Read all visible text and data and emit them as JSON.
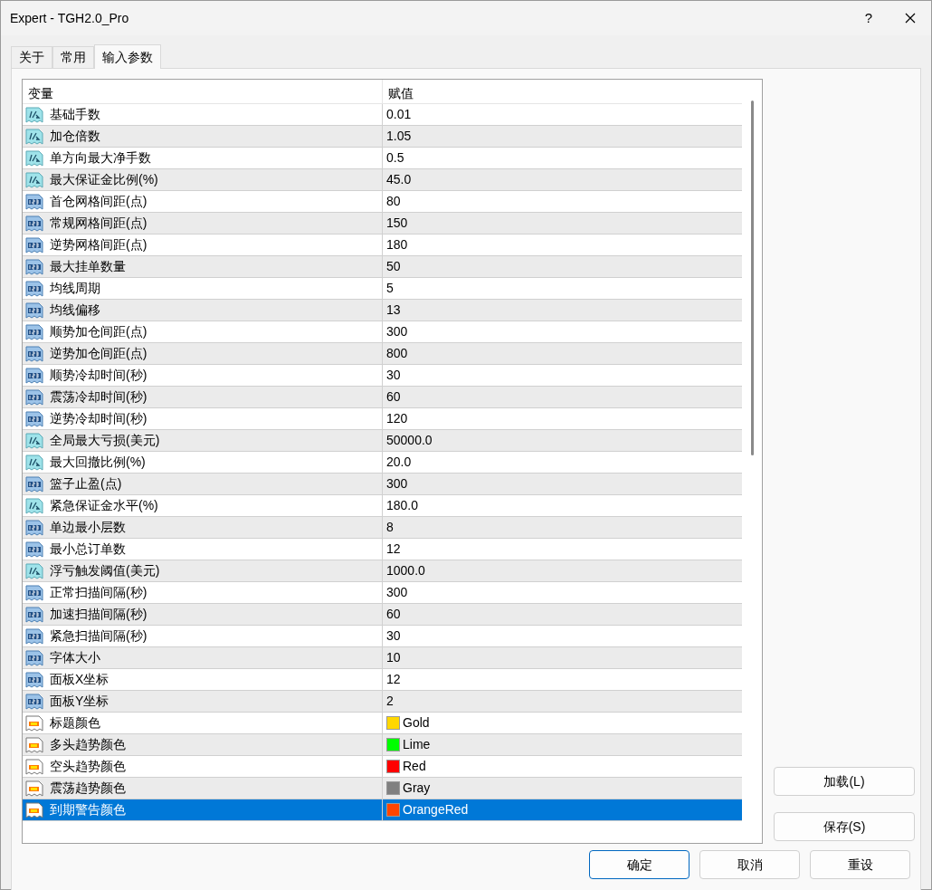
{
  "window": {
    "title": "Expert - TGH2.0_Pro",
    "help": "?"
  },
  "tabs": [
    {
      "label": "关于",
      "selected": false
    },
    {
      "label": "常用",
      "selected": false
    },
    {
      "label": "输入参数",
      "selected": true
    }
  ],
  "table": {
    "columns": [
      "变量",
      "赋值"
    ],
    "rows": [
      {
        "kind": "double",
        "name": "基础手数",
        "value": "0.01",
        "selected": false
      },
      {
        "kind": "double",
        "name": "加仓倍数",
        "value": "1.05",
        "selected": false
      },
      {
        "kind": "double",
        "name": "单方向最大净手数",
        "value": "0.5",
        "selected": false
      },
      {
        "kind": "double",
        "name": "最大保证金比例(%)",
        "value": "45.0",
        "selected": false
      },
      {
        "kind": "int",
        "name": "首仓网格间距(点)",
        "value": "80",
        "selected": false
      },
      {
        "kind": "int",
        "name": "常规网格间距(点)",
        "value": "150",
        "selected": false
      },
      {
        "kind": "int",
        "name": "逆势网格间距(点)",
        "value": "180",
        "selected": false
      },
      {
        "kind": "int",
        "name": "最大挂单数量",
        "value": "50",
        "selected": false
      },
      {
        "kind": "int",
        "name": "均线周期",
        "value": "5",
        "selected": false
      },
      {
        "kind": "int",
        "name": "均线偏移",
        "value": "13",
        "selected": false
      },
      {
        "kind": "int",
        "name": "顺势加仓间距(点)",
        "value": "300",
        "selected": false
      },
      {
        "kind": "int",
        "name": "逆势加仓间距(点)",
        "value": "800",
        "selected": false
      },
      {
        "kind": "int",
        "name": "顺势冷却时间(秒)",
        "value": "30",
        "selected": false
      },
      {
        "kind": "int",
        "name": "震荡冷却时间(秒)",
        "value": "60",
        "selected": false
      },
      {
        "kind": "int",
        "name": "逆势冷却时间(秒)",
        "value": "120",
        "selected": false
      },
      {
        "kind": "double",
        "name": "全局最大亏损(美元)",
        "value": "50000.0",
        "selected": false
      },
      {
        "kind": "double",
        "name": "最大回撤比例(%)",
        "value": "20.0",
        "selected": false
      },
      {
        "kind": "int",
        "name": "篮子止盈(点)",
        "value": "300",
        "selected": false
      },
      {
        "kind": "double",
        "name": "紧急保证金水平(%)",
        "value": "180.0",
        "selected": false
      },
      {
        "kind": "int",
        "name": "单边最小层数",
        "value": "8",
        "selected": false
      },
      {
        "kind": "int",
        "name": "最小总订单数",
        "value": "12",
        "selected": false
      },
      {
        "kind": "double",
        "name": "浮亏触发阈值(美元)",
        "value": "1000.0",
        "selected": false
      },
      {
        "kind": "int",
        "name": "正常扫描间隔(秒)",
        "value": "300",
        "selected": false
      },
      {
        "kind": "int",
        "name": "加速扫描间隔(秒)",
        "value": "60",
        "selected": false
      },
      {
        "kind": "int",
        "name": "紧急扫描间隔(秒)",
        "value": "30",
        "selected": false
      },
      {
        "kind": "int",
        "name": "字体大小",
        "value": "10",
        "selected": false
      },
      {
        "kind": "int",
        "name": "面板X坐标",
        "value": "12",
        "selected": false
      },
      {
        "kind": "int",
        "name": "面板Y坐标",
        "value": "2",
        "selected": false
      },
      {
        "kind": "color",
        "name": "标题颜色",
        "value": "Gold",
        "color": "#ffd700",
        "selected": false
      },
      {
        "kind": "color",
        "name": "多头趋势颜色",
        "value": "Lime",
        "color": "#00ff00",
        "selected": false
      },
      {
        "kind": "color",
        "name": "空头趋势颜色",
        "value": "Red",
        "color": "#ff0000",
        "selected": false
      },
      {
        "kind": "color",
        "name": "震荡趋势颜色",
        "value": "Gray",
        "color": "#808080",
        "selected": false
      },
      {
        "kind": "color",
        "name": "到期警告颜色",
        "value": "OrangeRed",
        "color": "#ff4500",
        "selected": true
      }
    ]
  },
  "side_buttons": [
    "加载(L)",
    "保存(S)"
  ],
  "buttons": [
    {
      "label": "确定",
      "default": true
    },
    {
      "label": "取消",
      "default": false
    },
    {
      "label": "重设",
      "default": false
    }
  ]
}
